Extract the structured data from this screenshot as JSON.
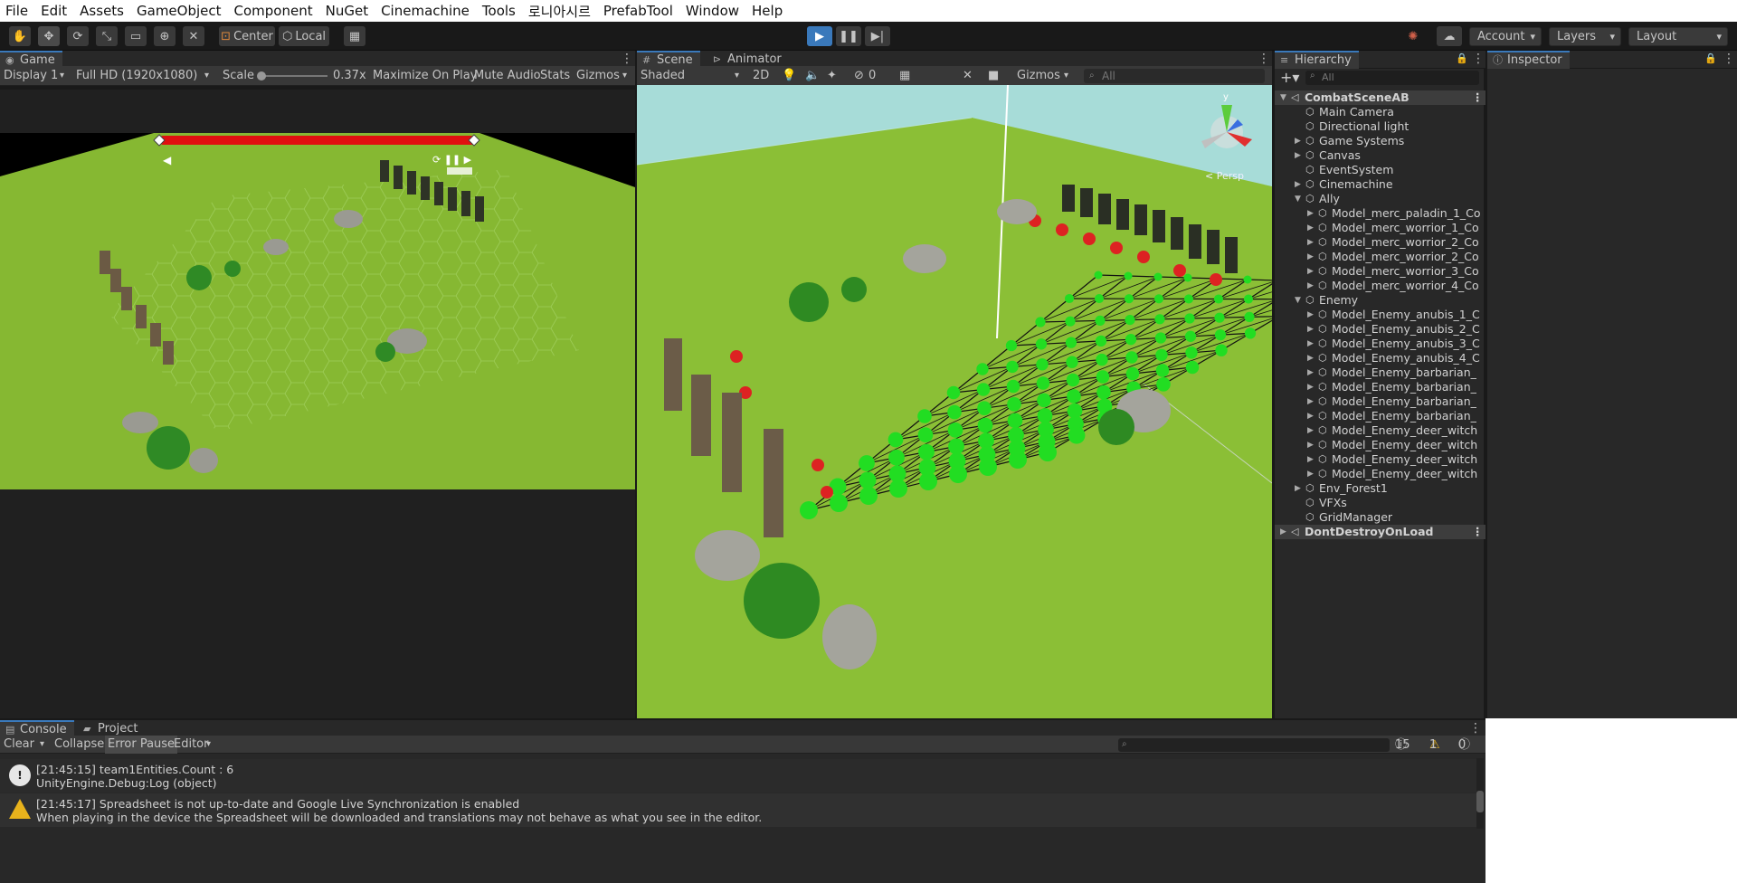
{
  "menu": [
    "File",
    "Edit",
    "Assets",
    "GameObject",
    "Component",
    "NuGet",
    "Cinemachine",
    "Tools",
    "로니아시르",
    "PrefabTool",
    "Window",
    "Help"
  ],
  "toolbar": {
    "center_label": "Center",
    "local_label": "Local",
    "account_label": "Account",
    "layers_label": "Layers",
    "layout_label": "Layout",
    "play_state": "playing"
  },
  "game_panel": {
    "tab_label": "Game",
    "display_label": "Display 1",
    "resolution_label": "Full HD (1920x1080)",
    "scale_label": "Scale",
    "scale_value": "0.37x",
    "maximize_label": "Maximize On Play",
    "mute_label": "Mute Audio",
    "stats_label": "Stats",
    "gizmos_label": "Gizmos",
    "health_fill": 1.0
  },
  "scene_panel": {
    "tabs": [
      "Scene",
      "Animator"
    ],
    "shading_label": "Shaded",
    "mode_2d_label": "2D",
    "hidden_count": "0",
    "gizmos_label": "Gizmos",
    "search_placeholder": "All",
    "gizmo_axis_label": "y",
    "persp_label": "< Persp"
  },
  "hierarchy": {
    "tab_label": "Hierarchy",
    "search_placeholder": "All",
    "root": "CombatSceneAB",
    "items": [
      {
        "label": "Main Camera",
        "depth": 1,
        "arrow": false
      },
      {
        "label": "Directional light",
        "depth": 1,
        "arrow": false
      },
      {
        "label": "Game Systems",
        "depth": 1,
        "arrow": "collapsed"
      },
      {
        "label": "Canvas",
        "depth": 1,
        "arrow": "collapsed"
      },
      {
        "label": "EventSystem",
        "depth": 1,
        "arrow": false
      },
      {
        "label": "Cinemachine",
        "depth": 1,
        "arrow": "collapsed"
      },
      {
        "label": "Ally",
        "depth": 1,
        "arrow": "expanded"
      },
      {
        "label": "Model_merc_paladin_1_Co",
        "depth": 2,
        "arrow": "collapsed"
      },
      {
        "label": "Model_merc_worrior_1_Co",
        "depth": 2,
        "arrow": "collapsed"
      },
      {
        "label": "Model_merc_worrior_2_Co",
        "depth": 2,
        "arrow": "collapsed"
      },
      {
        "label": "Model_merc_worrior_2_Co",
        "depth": 2,
        "arrow": "collapsed"
      },
      {
        "label": "Model_merc_worrior_3_Co",
        "depth": 2,
        "arrow": "collapsed"
      },
      {
        "label": "Model_merc_worrior_4_Co",
        "depth": 2,
        "arrow": "collapsed"
      },
      {
        "label": "Enemy",
        "depth": 1,
        "arrow": "expanded"
      },
      {
        "label": "Model_Enemy_anubis_1_C",
        "depth": 2,
        "arrow": "collapsed"
      },
      {
        "label": "Model_Enemy_anubis_2_C",
        "depth": 2,
        "arrow": "collapsed"
      },
      {
        "label": "Model_Enemy_anubis_3_C",
        "depth": 2,
        "arrow": "collapsed"
      },
      {
        "label": "Model_Enemy_anubis_4_C",
        "depth": 2,
        "arrow": "collapsed"
      },
      {
        "label": "Model_Enemy_barbarian_",
        "depth": 2,
        "arrow": "collapsed"
      },
      {
        "label": "Model_Enemy_barbarian_",
        "depth": 2,
        "arrow": "collapsed"
      },
      {
        "label": "Model_Enemy_barbarian_",
        "depth": 2,
        "arrow": "collapsed"
      },
      {
        "label": "Model_Enemy_barbarian_",
        "depth": 2,
        "arrow": "collapsed"
      },
      {
        "label": "Model_Enemy_deer_witch",
        "depth": 2,
        "arrow": "collapsed"
      },
      {
        "label": "Model_Enemy_deer_witch",
        "depth": 2,
        "arrow": "collapsed"
      },
      {
        "label": "Model_Enemy_deer_witch",
        "depth": 2,
        "arrow": "collapsed"
      },
      {
        "label": "Model_Enemy_deer_witch",
        "depth": 2,
        "arrow": "collapsed"
      },
      {
        "label": "Env_Forest1",
        "depth": 1,
        "arrow": "collapsed"
      },
      {
        "label": "VFXs",
        "depth": 1,
        "arrow": false
      },
      {
        "label": "GridManager",
        "depth": 1,
        "arrow": false
      }
    ],
    "dont_destroy": "DontDestroyOnLoad"
  },
  "inspector": {
    "tab_label": "Inspector"
  },
  "console": {
    "tabs": [
      "Console",
      "Project"
    ],
    "clear_label": "Clear",
    "collapse_label": "Collapse",
    "error_pause_label": "Error Pause",
    "editor_label": "Editor",
    "log_count": "15",
    "warn_count": "1",
    "error_count": "0",
    "messages": [
      {
        "type": "log",
        "line1": "[21:45:15] team1Entities.Count : 6",
        "line2": "UnityEngine.Debug:Log (object)"
      },
      {
        "type": "warning",
        "line1": "[21:45:17] Spreadsheet is not up-to-date and Google Live Synchronization is enabled",
        "line2": "When playing in the device the Spreadsheet will be downloaded and translations may not behave as what you see in the editor."
      }
    ]
  },
  "colors": {
    "accent": "#3a79bb",
    "play_active": "#3a79bb",
    "grass": "#86b832",
    "grid_node": "#22dd22",
    "enemy_marker": "#dd2222",
    "health_bar": "#e01010",
    "sky": "#a7dcd8"
  }
}
